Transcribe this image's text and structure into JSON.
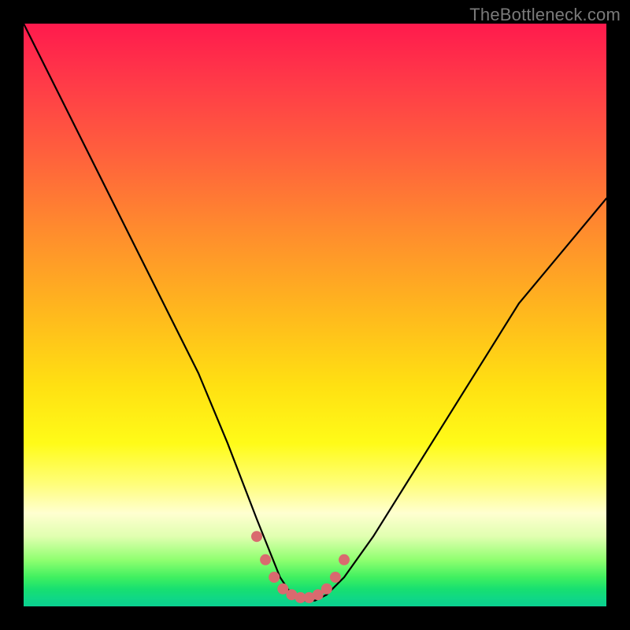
{
  "watermark": "TheBottleneck.com",
  "chart_data": {
    "type": "line",
    "title": "",
    "xlabel": "",
    "ylabel": "",
    "xlim": [
      0,
      100
    ],
    "ylim": [
      0,
      100
    ],
    "series": [
      {
        "name": "bottleneck-curve",
        "x": [
          0,
          5,
          10,
          15,
          20,
          25,
          30,
          35,
          40,
          42,
          44,
          46,
          48,
          50,
          52,
          55,
          60,
          65,
          70,
          75,
          80,
          85,
          90,
          95,
          100
        ],
        "values": [
          100,
          90,
          80,
          70,
          60,
          50,
          40,
          28,
          15,
          10,
          5,
          2,
          1,
          1,
          2,
          5,
          12,
          20,
          28,
          36,
          44,
          52,
          58,
          64,
          70
        ]
      }
    ],
    "markers": {
      "name": "trough-dots",
      "x": [
        40,
        41.5,
        43,
        44.5,
        46,
        47.5,
        49,
        50.5,
        52,
        53.5,
        55
      ],
      "values": [
        12,
        8,
        5,
        3,
        2,
        1.5,
        1.5,
        2,
        3,
        5,
        8
      ]
    },
    "colors": {
      "curve": "#000000",
      "markers": "#d96a6f"
    }
  }
}
